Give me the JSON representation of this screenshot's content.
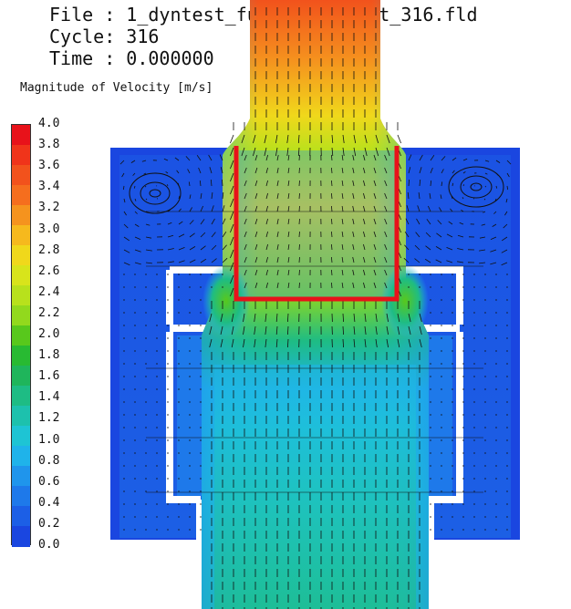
{
  "header": {
    "file_line": "File : 1_dyntest_fullgeo_1_stst_316.fld",
    "cycle_line": "Cycle: 316",
    "time_line": "Time : 0.000000"
  },
  "colorbar": {
    "title": "Magnitude of Velocity [m/s]",
    "ticks": [
      "4.0",
      "3.8",
      "3.6",
      "3.4",
      "3.2",
      "3.0",
      "2.8",
      "2.6",
      "2.4",
      "2.2",
      "2.0",
      "1.8",
      "1.6",
      "1.4",
      "1.2",
      "1.0",
      "0.8",
      "0.6",
      "0.4",
      "0.2",
      "0.0"
    ],
    "colors": [
      "#e8121a",
      "#f0341a",
      "#f2521c",
      "#f56e1e",
      "#f5931e",
      "#f6b91d",
      "#f0d81b",
      "#d8e41b",
      "#b8e11c",
      "#92d91d",
      "#58c81c",
      "#28ba32",
      "#1fb55b",
      "#1ebc84",
      "#1dc1ad",
      "#1ec4d4",
      "#1fb3ea",
      "#1f95ec",
      "#1e79ea",
      "#1c5fe6",
      "#1a46e0"
    ]
  },
  "colors": {
    "cup_outline": "#e8121a",
    "divider": "#ffffff",
    "vectors": "#111111"
  }
}
